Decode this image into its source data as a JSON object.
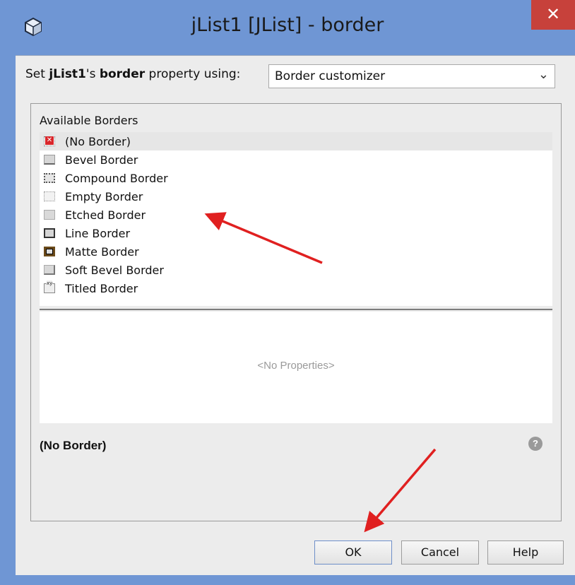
{
  "window": {
    "title": "jList1 [JList] - border",
    "close_label": "✕"
  },
  "set_row": {
    "prefix": "Set ",
    "component": "jList1",
    "possessive": "'s ",
    "property": "border",
    "suffix": " property using:",
    "selected": "Border customizer"
  },
  "panel": {
    "available_label": "Available Borders",
    "items": [
      {
        "label": "(No Border)",
        "icon": "no-border-icon"
      },
      {
        "label": "Bevel Border",
        "icon": "bevel-border-icon"
      },
      {
        "label": "Compound Border",
        "icon": "compound-border-icon"
      },
      {
        "label": "Empty Border",
        "icon": "empty-border-icon"
      },
      {
        "label": "Etched Border",
        "icon": "etched-border-icon"
      },
      {
        "label": "Line Border",
        "icon": "line-border-icon"
      },
      {
        "label": "Matte Border",
        "icon": "matte-border-icon"
      },
      {
        "label": "Soft Bevel Border",
        "icon": "soft-bevel-border-icon"
      },
      {
        "label": "Titled Border",
        "icon": "titled-border-icon"
      }
    ],
    "no_properties": "<No Properties>",
    "selected_border_name": "(No Border)",
    "help_glyph": "?"
  },
  "buttons": {
    "ok": "OK",
    "cancel": "Cancel",
    "help": "Help"
  },
  "colors": {
    "titlebar": "#6f96d4",
    "close": "#c7413b",
    "arrow": "#e02020"
  }
}
